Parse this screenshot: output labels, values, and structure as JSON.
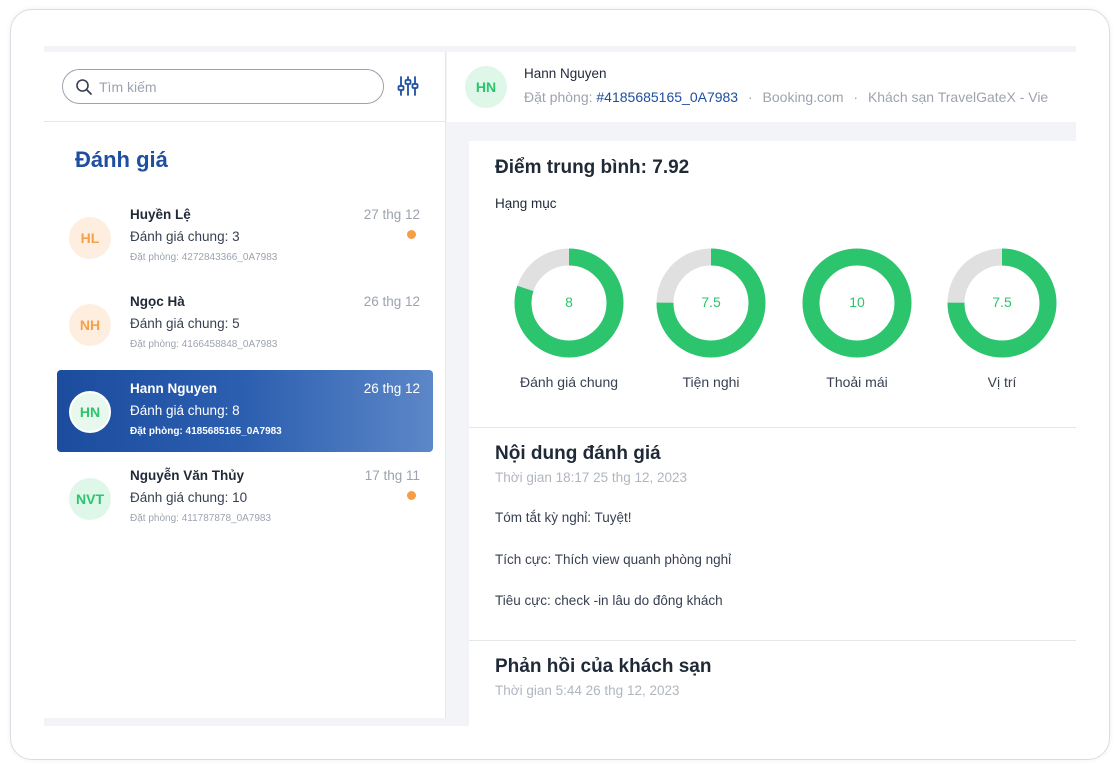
{
  "search": {
    "placeholder": "Tìm kiếm"
  },
  "sidebar": {
    "title": "Đánh giá",
    "reviews": [
      {
        "initials": "HL",
        "name": "Huyền Lệ",
        "overall": "Đánh giá chung: 3",
        "booking": "Đặt phòng: 4272843366_0A7983",
        "date": "27 thg 12",
        "unread": true,
        "avatar_color": "orange"
      },
      {
        "initials": "NH",
        "name": "Ngọc Hà",
        "overall": "Đánh giá chung: 5",
        "booking": "Đặt phòng: 4166458848_0A7983",
        "date": "26 thg 12",
        "unread": false,
        "avatar_color": "orange"
      },
      {
        "initials": "HN",
        "name": "Hann Nguyen",
        "overall": "Đánh giá chung: 8",
        "booking": "Đặt phòng: 4185685165_0A7983",
        "date": "26 thg 12",
        "unread": false,
        "avatar_color": "green",
        "selected": true
      },
      {
        "initials": "NVT",
        "name": "Nguyễn Văn Thủy",
        "overall": "Đánh giá chung: 10",
        "booking": "Đặt phòng: 411787878_0A7983",
        "date": "17 thg 11",
        "unread": true,
        "avatar_color": "green"
      }
    ]
  },
  "header": {
    "initials": "HN",
    "name": "Hann Nguyen",
    "booking_label": "Đặt phòng:",
    "booking_id": "#4185685165_0A7983",
    "channel": "Booking.com",
    "hotel": "Khách sạn TravelGateX - Vie",
    "separator": "·"
  },
  "score": {
    "average": "Điểm trung bình: 7.92",
    "category_label": "Hạng mục",
    "categories": [
      {
        "name": "Đánh giá chung",
        "value": "8",
        "score": 8,
        "max": 10
      },
      {
        "name": "Tiện nghi",
        "value": "7.5",
        "score": 7.5,
        "max": 10
      },
      {
        "name": "Thoải mái",
        "value": "10",
        "score": 10,
        "max": 10
      },
      {
        "name": "Vị trí",
        "value": "7.5",
        "score": 7.5,
        "max": 10
      }
    ]
  },
  "content": {
    "title": "Nội dung đánh giá",
    "time": "Thời gian 18:17 25 thg 12, 2023",
    "summary": "Tóm tắt kỳ nghỉ: Tuyệt!",
    "positive": "Tích cực: Thích view quanh phòng nghỉ",
    "negative": "Tiêu cực: check -in lâu do đông khách"
  },
  "reply": {
    "title": "Phản hồi của khách sạn",
    "time": "Thời gian 5:44 26 thg 12, 2023"
  },
  "colors": {
    "accent_blue": "#1e4fa0",
    "donut_green": "#2cc46d",
    "donut_track": "#e0e0e0",
    "unread_dot": "#f59e42"
  }
}
